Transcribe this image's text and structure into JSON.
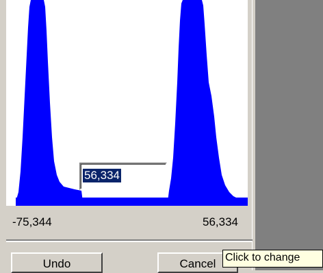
{
  "histogram": {
    "min_label": "-75,344",
    "max_label": "56,334",
    "fill_color": "#0000ff"
  },
  "value_field": {
    "value": "56,334"
  },
  "buttons": {
    "undo_label": "Undo",
    "cancel_label": "Cancel"
  },
  "tooltip": {
    "text": "Click to change"
  }
}
